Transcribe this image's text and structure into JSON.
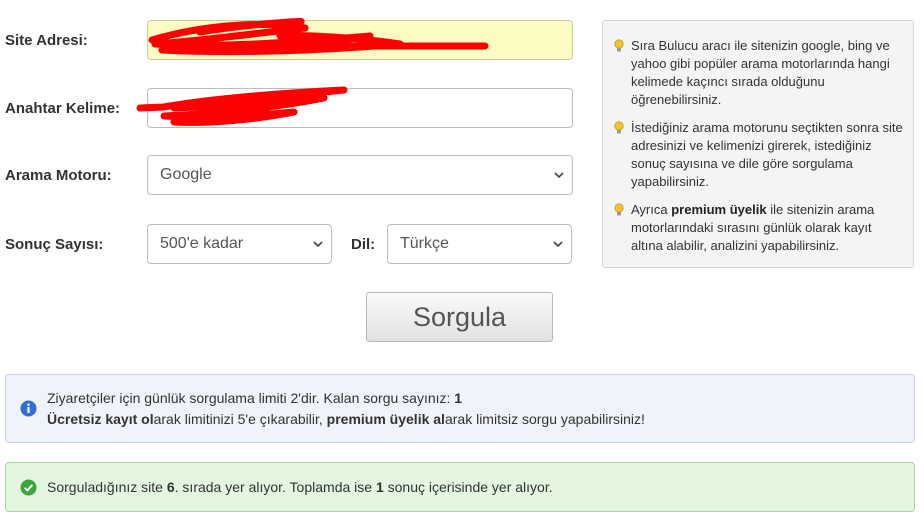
{
  "form": {
    "site_label": "Site Adresi:",
    "keyword_label": "Anahtar Kelime:",
    "engine_label": "Arama Motoru:",
    "engine_value": "Google",
    "count_label": "Sonuç Sayısı:",
    "count_value": "500'e kadar",
    "lang_label": "Dil:",
    "lang_value": "Türkçe",
    "submit_label": "Sorgula"
  },
  "info": {
    "tip1": "Sıra Bulucu aracı ile sitenizin google, bing ve yahoo gibi popüler arama motorlarında hangi kelimede kaçıncı sırada olduğunu öğrenebilirsiniz.",
    "tip2": "İstediğiniz arama motorunu seçtikten sonra site adresinizi ve kelimenizi girerek, istediğiniz sonuç sayısına ve dile göre sorgulama yapabilirsiniz.",
    "tip3_pre": "Ayrıca ",
    "tip3_bold": "premium üyelik",
    "tip3_post": " ile sitenizin arama motorlarındaki sırasını günlük olarak kayıt altına alabilir, analizini yapabilirsiniz."
  },
  "limit_alert": {
    "line1_text": "Ziyaretçiler için günlük sorgulama limiti 2'dir. Kalan sorgu sayınız: ",
    "line1_count": "1",
    "line2_bold1": "Ücretsiz kayıt ol",
    "line2_text1": "arak limitinizi 5'e çıkarabilir, ",
    "line2_bold2": "premium üyelik al",
    "line2_text2": "arak limitsiz sorgu yapabilirsiniz!"
  },
  "result_alert": {
    "text1": "Sorguladığınız site ",
    "rank": "6",
    "text2": ". sırada yer alıyor. Toplamda ise ",
    "total": "1",
    "text3": " sonuç içerisinde yer alıyor."
  },
  "colors": {
    "site_field_bg": "#fbfbc2",
    "redaction": "#ff0000",
    "info_icon": "#2f6fd6",
    "success_icon": "#3aa53a"
  }
}
